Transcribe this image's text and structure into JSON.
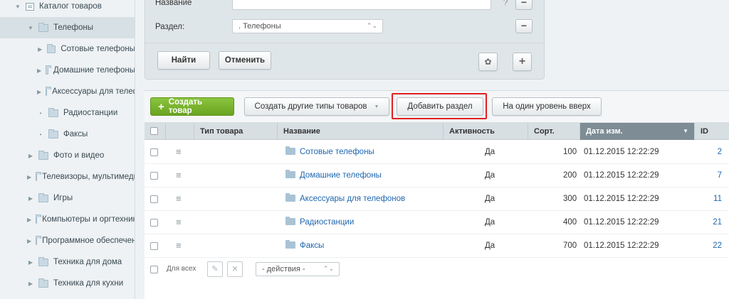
{
  "sidebar": {
    "items": [
      {
        "label": "Каталог товаров",
        "level": 0,
        "icon": "catalog-icon",
        "arrow": "down"
      },
      {
        "label": "Телефоны",
        "level": 1,
        "icon": "folder-icon",
        "arrow": "down",
        "active": true
      },
      {
        "label": "Сотовые телефоны",
        "level": 2,
        "icon": "folder-icon",
        "arrow": "right"
      },
      {
        "label": "Домашние телефоны",
        "level": 2,
        "icon": "folder-icon",
        "arrow": "right"
      },
      {
        "label": "Аксессуары для телефонов",
        "level": 2,
        "icon": "folder-icon",
        "arrow": "right"
      },
      {
        "label": "Радиостанции",
        "level": 2,
        "icon": "folder-icon",
        "arrow": "dot"
      },
      {
        "label": "Факсы",
        "level": 2,
        "icon": "folder-icon",
        "arrow": "dot"
      },
      {
        "label": "Фото и видео",
        "level": 1,
        "icon": "folder-icon",
        "arrow": "right"
      },
      {
        "label": "Телевизоры, мультимедиа",
        "level": 1,
        "icon": "folder-icon",
        "arrow": "right"
      },
      {
        "label": "Игры",
        "level": 1,
        "icon": "folder-icon",
        "arrow": "right"
      },
      {
        "label": "Компьютеры и оргтехника",
        "level": 1,
        "icon": "folder-icon",
        "arrow": "right"
      },
      {
        "label": "Программное обеспечение",
        "level": 1,
        "icon": "folder-icon",
        "arrow": "right"
      },
      {
        "label": "Техника для дома",
        "level": 1,
        "icon": "folder-icon",
        "arrow": "right"
      },
      {
        "label": "Техника для кухни",
        "level": 1,
        "icon": "folder-icon",
        "arrow": "right"
      }
    ]
  },
  "filter": {
    "name_label": "Название",
    "name_value": "",
    "section_label": "Раздел:",
    "section_value": ". Телефоны",
    "find_label": "Найти",
    "cancel_label": "Отменить",
    "minus_glyph": "−",
    "gear_glyph": "✿",
    "plus_glyph": "+",
    "question_glyph": "?"
  },
  "toolbar": {
    "create_label": "Создать товар",
    "create_other_label": "Создать другие типы товаров",
    "add_section_label": "Добавить раздел",
    "level_up_label": "На один уровень вверх",
    "plus_glyph": "+",
    "dropdown_glyph": "▼"
  },
  "table": {
    "columns": [
      "Тип товара",
      "Название",
      "Активность",
      "Сорт.",
      "Дата изм.",
      "ID"
    ],
    "sorted_arrow": "▼",
    "rows": [
      {
        "name": "Сотовые телефоны",
        "active": "Да",
        "sort": "100",
        "date": "01.12.2015 12:22:29",
        "id": "2"
      },
      {
        "name": "Домашние телефоны",
        "active": "Да",
        "sort": "200",
        "date": "01.12.2015 12:22:29",
        "id": "7"
      },
      {
        "name": "Аксессуары для телефонов",
        "active": "Да",
        "sort": "300",
        "date": "01.12.2015 12:22:29",
        "id": "11"
      },
      {
        "name": "Радиостанции",
        "active": "Да",
        "sort": "400",
        "date": "01.12.2015 12:22:29",
        "id": "21"
      },
      {
        "name": "Факсы",
        "active": "Да",
        "sort": "700",
        "date": "01.12.2015 12:22:29",
        "id": "22"
      }
    ],
    "row_menu_glyph": "≡"
  },
  "footer": {
    "for_all_label": "Для всех",
    "actions_value": "- действия -",
    "edit_glyph": "✎",
    "delete_glyph": "✕",
    "select_arrows": "⌃⌄"
  },
  "colors": {
    "accent_green": "#76b82a",
    "highlight_red": "#e02020",
    "link_blue": "#2067b0",
    "sorted_header": "#7d8c95"
  }
}
